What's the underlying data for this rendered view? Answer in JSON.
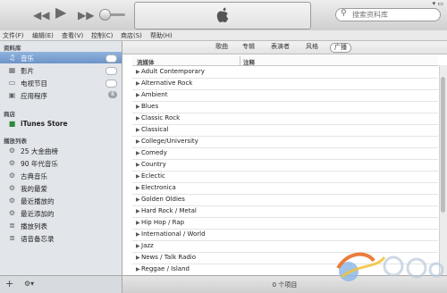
{
  "player": {
    "search_placeholder": "搜索资料库",
    "window_controls": "▾  ▭"
  },
  "menu": [
    "文件(F)",
    "编辑(E)",
    "查看(V)",
    "控制(C)",
    "商店(S)",
    "帮助(H)"
  ],
  "sidebar": {
    "library_heading": "资料库",
    "library_items": [
      {
        "label": "音乐",
        "icon": "music-note-icon",
        "selected": true,
        "accessory": "cloud"
      },
      {
        "label": "影片",
        "icon": "film-icon",
        "selected": false,
        "accessory": "cloud"
      },
      {
        "label": "电视节目",
        "icon": "tv-icon",
        "selected": false,
        "accessory": "cloud"
      },
      {
        "label": "应用程序",
        "icon": "app-icon",
        "selected": false,
        "accessory": "badge",
        "badge": "8"
      }
    ],
    "store_heading": "商店",
    "store_items": [
      {
        "label": "iTunes Store",
        "icon": "store-bag-icon"
      }
    ],
    "playlists_heading": "播放列表",
    "playlists": [
      {
        "label": "25 大金曲榜",
        "icon": "smart-playlist-gear-icon"
      },
      {
        "label": "90 年代音乐",
        "icon": "smart-playlist-gear-icon"
      },
      {
        "label": "古典音乐",
        "icon": "smart-playlist-gear-icon"
      },
      {
        "label": "我的最爱",
        "icon": "smart-playlist-gear-icon"
      },
      {
        "label": "最近播放的",
        "icon": "smart-playlist-gear-icon"
      },
      {
        "label": "最近添加的",
        "icon": "smart-playlist-gear-icon"
      },
      {
        "label": "播放列表",
        "icon": "playlist-icon"
      },
      {
        "label": "语音备忘录",
        "icon": "playlist-icon"
      }
    ],
    "footer": {
      "add": "+",
      "settings": "⚙▾"
    }
  },
  "tabs": [
    {
      "label": "歌曲",
      "active": false
    },
    {
      "label": "专辑",
      "active": false
    },
    {
      "label": "表演者",
      "active": false
    },
    {
      "label": "风格",
      "active": false
    },
    {
      "label": "广播",
      "active": true
    }
  ],
  "table": {
    "columns": [
      "流媒体",
      "注释"
    ],
    "rows": [
      "Adult Contemporary",
      "Alternative Rock",
      "Ambient",
      "Blues",
      "Classic Rock",
      "Classical",
      "College/University",
      "Comedy",
      "Country",
      "Eclectic",
      "Electronica",
      "Golden Oldies",
      "Hard Rock / Metal",
      "Hip Hop / Rap",
      "International / World",
      "Jazz",
      "News / Talk Radio",
      "Reggae / Island"
    ]
  },
  "status": {
    "item_count": "0 个项目"
  },
  "colors": {
    "selection": "#7a9fd0",
    "sidebar_bg": "#e2e5ea"
  }
}
